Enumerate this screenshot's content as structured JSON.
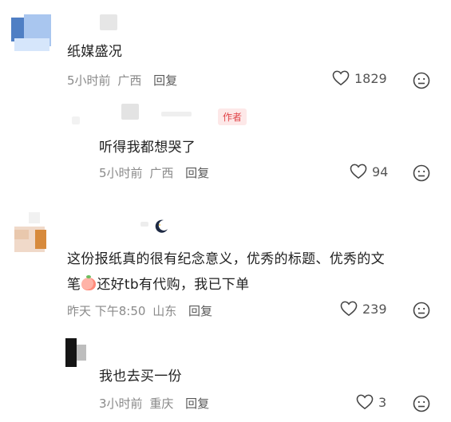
{
  "comments": [
    {
      "text": "纸媒盛况",
      "time": "5小时前",
      "location": "广西",
      "reply_label": "回复",
      "likes": "1829"
    },
    {
      "text": "听得我都想哭了",
      "author_tag": "作者",
      "time": "5小时前",
      "location": "广西",
      "reply_label": "回复",
      "likes": "94"
    },
    {
      "text_line1": "这份报纸真的很有纪念意义，优秀的标题、优秀的文",
      "text_line2_a": "笔",
      "text_line2_b": "还好tb有代购，我已下单",
      "time": "昨天 下午8:50",
      "location": "山东",
      "reply_label": "回复",
      "likes": "239"
    },
    {
      "text": "我也去买一份",
      "time": "3小时前",
      "location": "重庆",
      "reply_label": "回复",
      "likes": "3"
    }
  ],
  "icons": {
    "like": "heart-outline-icon",
    "dislike": "frown-face-icon",
    "emoji_inline": "peach-emoji",
    "moon": "moon-icon"
  },
  "colors": {
    "author_tag_bg": "#fde8e8",
    "author_tag_text": "#e0454a",
    "meta_text": "#8a8a8a"
  }
}
